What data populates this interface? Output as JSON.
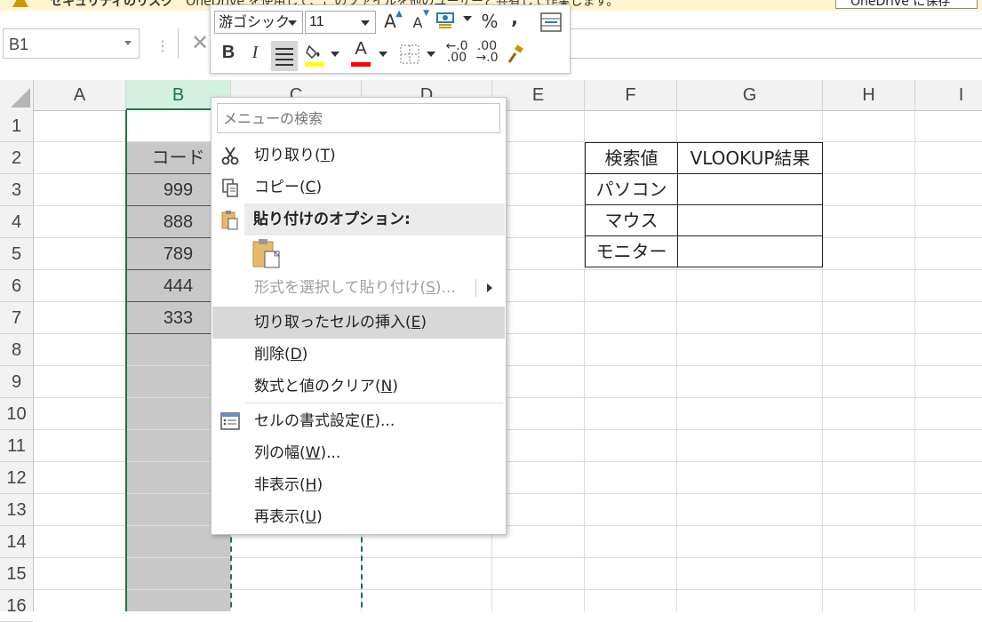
{
  "notification": {
    "title": "セキュリティのリスク",
    "message": "OneDrive を使用して、このファイルを他のユーザーと共有して作業します。",
    "button": "OneDrive に保存"
  },
  "formula_bar": {
    "name_box": "B1",
    "separator": "⋮",
    "cancel_icon": "✕",
    "formula": ""
  },
  "columns": [
    {
      "label": "A",
      "selected": false
    },
    {
      "label": "B",
      "selected": true
    },
    {
      "label": "C",
      "selected": false
    },
    {
      "label": "D",
      "selected": false
    },
    {
      "label": "E",
      "selected": false
    },
    {
      "label": "F",
      "selected": false
    },
    {
      "label": "G",
      "selected": false
    },
    {
      "label": "H",
      "selected": false
    },
    {
      "label": "I",
      "selected": false
    }
  ],
  "rows": [
    "1",
    "2",
    "3",
    "4",
    "5",
    "6",
    "7",
    "8",
    "9",
    "10",
    "11",
    "12",
    "13",
    "14",
    "15",
    "16"
  ],
  "column_b": {
    "header": "コード",
    "values": [
      "999",
      "888",
      "789",
      "444",
      "333"
    ]
  },
  "lookup_table": {
    "headers": [
      "検索値",
      "VLOOKUP結果"
    ],
    "rows": [
      [
        "パソコン",
        ""
      ],
      [
        "マウス",
        ""
      ],
      [
        "モニター",
        ""
      ]
    ]
  },
  "mini_toolbar": {
    "font_name": "游ゴシック",
    "font_size": "11",
    "grow_font": "A",
    "shrink_font": "A",
    "percent": "%",
    "comma": ",",
    "bold": "B",
    "italic": "I",
    "font_color_letter": "A",
    "inc_decimal_top": "←.0",
    "inc_decimal_bottom": ".00",
    "dec_decimal_top": ".00",
    "dec_decimal_bottom": "→.0",
    "highlight_color": "#ffff00",
    "font_color": "#ff0000"
  },
  "context_menu": {
    "search_placeholder": "メニューの検索",
    "items": [
      {
        "label": "切り取り(",
        "key": "T",
        "tail": ")"
      },
      {
        "label": "コピー(",
        "key": "C",
        "tail": ")"
      },
      {
        "label": "貼り付けのオプション:"
      },
      {
        "label": "形式を選択して貼り付け(",
        "key": "S",
        "tail": ")..."
      },
      {
        "label": "切り取ったセルの挿入(",
        "key": "E",
        "tail": ")"
      },
      {
        "label": "削除(",
        "key": "D",
        "tail": ")"
      },
      {
        "label": "数式と値のクリア(",
        "key": "N",
        "tail": ")"
      },
      {
        "label": "セルの書式設定(",
        "key": "F",
        "tail": ")..."
      },
      {
        "label": "列の幅(",
        "key": "W",
        "tail": ")..."
      },
      {
        "label": "非表示(",
        "key": "H",
        "tail": ")"
      },
      {
        "label": "再表示(",
        "key": "U",
        "tail": ")"
      }
    ]
  }
}
